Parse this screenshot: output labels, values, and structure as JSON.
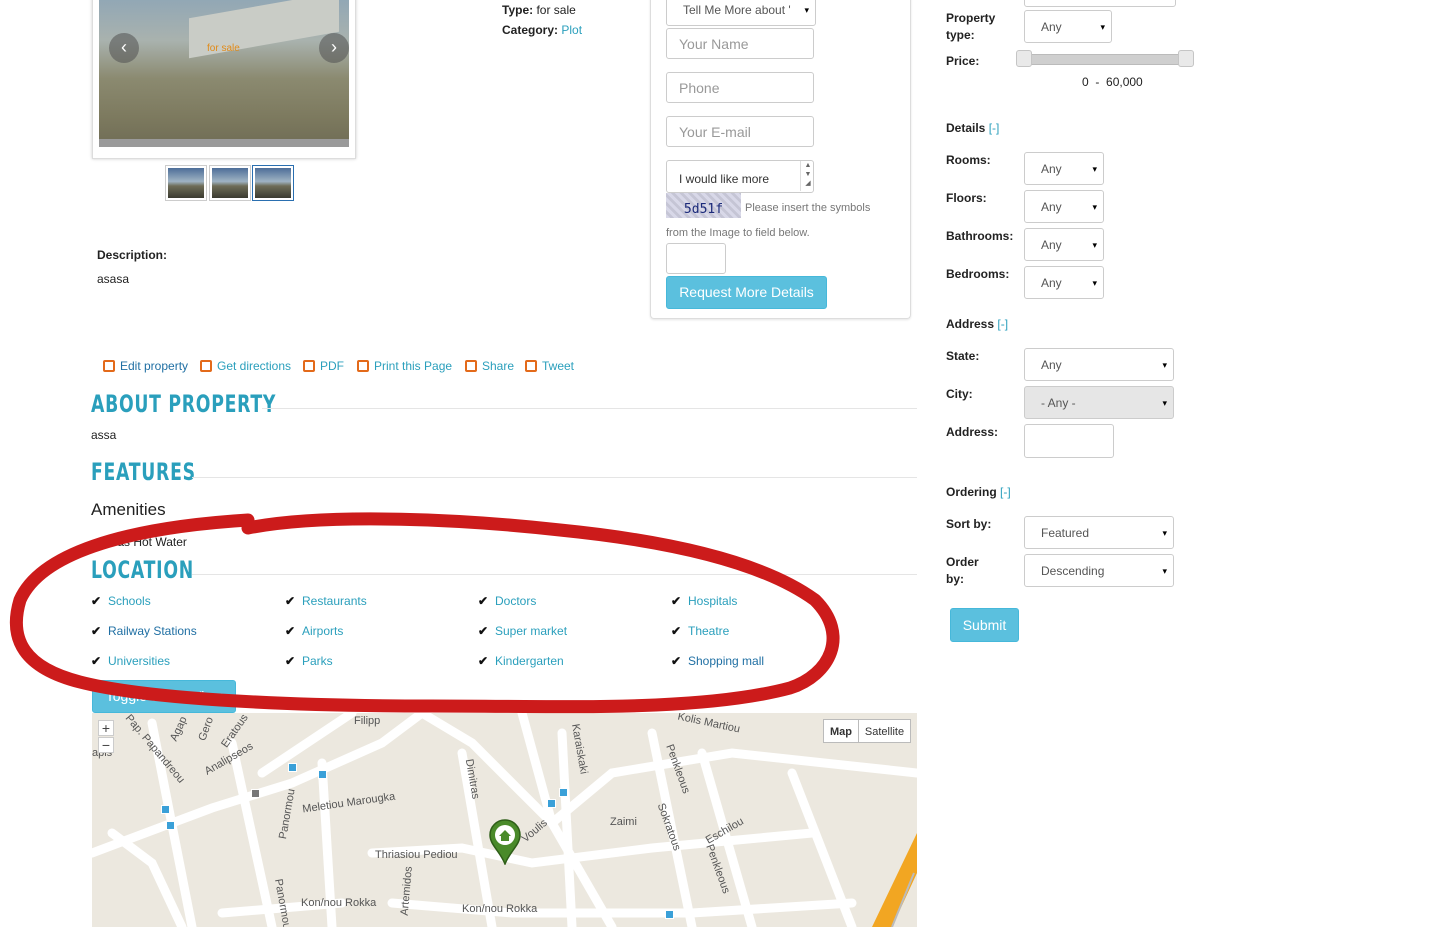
{
  "gallery": {
    "photo_tag": "for sale",
    "prev": "‹",
    "next": "›"
  },
  "info": {
    "type_label": "Type:",
    "type_value": "for sale",
    "category_label": "Category:",
    "category_value": "Plot"
  },
  "form": {
    "subject_select": "Tell Me More about '",
    "name_placeholder": "Your Name",
    "phone_placeholder": "Phone",
    "email_placeholder": "Your E-mail",
    "message_value": "I would like more",
    "captcha_text": "5d51f",
    "captcha_hint": "Please insert the symbols from the Image to field below.",
    "submit_label": "Request More Details"
  },
  "description": {
    "label": "Description:",
    "value": "asasa"
  },
  "actions": [
    {
      "label": "Edit property"
    },
    {
      "label": "Get directions"
    },
    {
      "label": "PDF"
    },
    {
      "label": "Print this Page"
    },
    {
      "label": "Share"
    },
    {
      "label": "Tweet"
    }
  ],
  "about": {
    "heading": "ABOUT PROPERTY",
    "text": "assa"
  },
  "features": {
    "heading": "FEATURES",
    "group_title": "Amenities",
    "items": [
      "Gas Hot Water"
    ]
  },
  "location": {
    "heading": "LOCATION",
    "items": [
      "Schools",
      "Restaurants",
      "Doctors",
      "Hospitals",
      "Railway Stations",
      "Airports",
      "Super market",
      "Theatre",
      "Universities",
      "Parks",
      "Kindergarten",
      "Shopping mall"
    ]
  },
  "map": {
    "toggle_label": "Toggle Street View",
    "map_label": "Map",
    "satellite_label": "Satellite",
    "zoom_in": "+",
    "zoom_out": "−",
    "streets": [
      "Filipp",
      "Kolis Martiou",
      "Karaiskaki",
      "Pap. Papandreou",
      "Agap",
      "Gero",
      "Eratous",
      "Analipseos",
      "Dimitras",
      "Penkleous",
      "Meletiou Marougka",
      "Panormou",
      "Voulis",
      "Zaimi",
      "Sokratous",
      "Eschilou",
      "Penkleous",
      "Thriasiou Pediou",
      "Artemidos",
      "Kon/nou Rokka",
      "Kon/nou Rokka",
      "Panormou",
      "apis"
    ]
  },
  "sidebar": {
    "property_type_label": "Property type:",
    "property_type_value": "Any",
    "price_label": "Price:",
    "price_min": "0",
    "price_sep": "-",
    "price_max": "60,000",
    "price_range": [
      0,
      60000
    ],
    "details_heading": "Details",
    "toggle": "[-]",
    "rooms_label": "Rooms:",
    "rooms_value": "Any",
    "floors_label": "Floors:",
    "floors_value": "Any",
    "bathrooms_label": "Bathrooms:",
    "bathrooms_value": "Any",
    "bedrooms_label": "Bedrooms:",
    "bedrooms_value": "Any",
    "address_heading": "Address",
    "state_label": "State:",
    "state_value": "Any",
    "city_label": "City:",
    "city_value": "- Any -",
    "address_label": "Address:",
    "ordering_heading": "Ordering",
    "sortby_label": "Sort by:",
    "sortby_value": "Featured",
    "orderby_label": "Order by:",
    "orderby_value": "Descending",
    "submit_label": "Submit"
  },
  "colors": {
    "accent": "#2a9fbc",
    "button": "#5bc0de",
    "annotation": "#cc1b1b",
    "marker": "#4a8a2a"
  },
  "caret": "▾",
  "tick": "✔"
}
